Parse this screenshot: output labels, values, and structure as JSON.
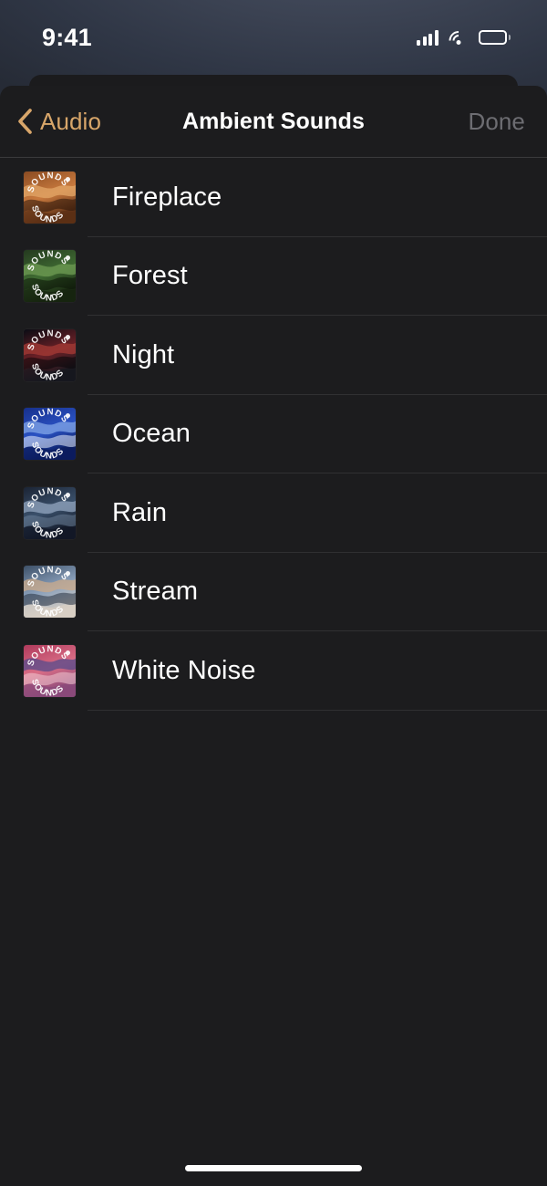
{
  "status_bar": {
    "time": "9:41",
    "cellular_icon": "cellular-signal-icon",
    "wifi_icon": "wifi-icon",
    "battery_icon": "battery-full-icon"
  },
  "nav": {
    "back_icon": "chevron-left-icon",
    "back_label": "Audio",
    "title": "Ambient Sounds",
    "done_label": "Done",
    "back_color": "#d8a66a",
    "done_color": "#6d6d72",
    "title_color": "#ffffff"
  },
  "list": {
    "items": [
      {
        "label": "Fireplace",
        "artwork_name": "fireplace-artwork",
        "colors": [
          "#8a4b22",
          "#c97a3e",
          "#e2a566",
          "#5b2f15",
          "#2a1409"
        ]
      },
      {
        "label": "Forest",
        "artwork_name": "forest-artwork",
        "colors": [
          "#24391f",
          "#3f6b32",
          "#6d9a52",
          "#16240f",
          "#0b1408"
        ]
      },
      {
        "label": "Night",
        "artwork_name": "night-artwork",
        "colors": [
          "#0a0c14",
          "#6b2026",
          "#a33a34",
          "#16181f",
          "#050609"
        ]
      },
      {
        "label": "Ocean",
        "artwork_name": "ocean-artwork",
        "colors": [
          "#17308c",
          "#2a52c4",
          "#7fa3e6",
          "#0b1c5e",
          "#e8eefc"
        ]
      },
      {
        "label": "Rain",
        "artwork_name": "rain-artwork",
        "colors": [
          "#1b2435",
          "#3a506b",
          "#8fa3bd",
          "#121827",
          "#6a7d96"
        ]
      },
      {
        "label": "Stream",
        "artwork_name": "stream-artwork",
        "colors": [
          "#3d5068",
          "#8aa0bb",
          "#c8a98c",
          "#d8cfc4",
          "#24303f"
        ]
      },
      {
        "label": "White Noise",
        "artwork_name": "white-noise-artwork",
        "colors": [
          "#b03a5c",
          "#d96d86",
          "#5b4b8a",
          "#8a4a7a",
          "#f0c8d2"
        ]
      }
    ],
    "artwork_caption": "SOUNDS"
  },
  "home_indicator": "home-indicator"
}
